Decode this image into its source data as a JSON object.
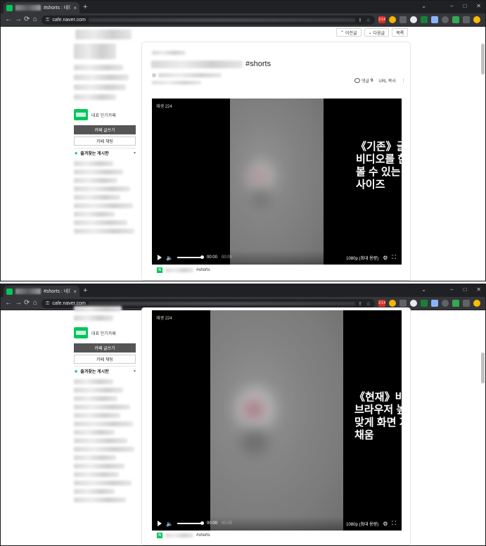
{
  "browser": {
    "tab_title": "#shorts : 네이버",
    "tab_close": "×",
    "new_tab": "+",
    "url": "cafe.naver.com",
    "window_controls": [
      "–",
      "□",
      "✕"
    ],
    "chevron": "⌄",
    "nav": {
      "back": "←",
      "forward": "→",
      "reload": "⟳",
      "home": "⌂"
    },
    "lock": "🔒",
    "ext_badge": "2:14"
  },
  "top": {
    "nav_buttons": {
      "prev": "이전글",
      "next": "다음글",
      "list": "목록"
    },
    "sidebar": {
      "badge_label": "대표 인기카페",
      "write_button": "카페 글쓰기",
      "chat_button": "카페 채팅",
      "favorites_label": "즐겨찾는 게시판"
    },
    "post": {
      "title_tag": "#shorts",
      "comment_label": "댓글",
      "comment_count": "9",
      "url_copy": "URL 복사",
      "more": "⋮"
    },
    "video": {
      "label": "재생 224",
      "time_current": "00:00",
      "time_total": "00:05",
      "quality": "1080p (최대 용량)"
    },
    "under_video_tag": "#shorts",
    "caption": "《기존》글 제목과\n비디오를 한 눈에\n볼 수 있는 적당한\n사이즈"
  },
  "bottom": {
    "sidebar": {
      "badge_label": "대표 인기카페",
      "write_button": "카페 글쓰기",
      "chat_button": "카페 채팅",
      "favorites_label": "즐겨찾는 게시판"
    },
    "video": {
      "label": "재생 224",
      "time_current": "00:00",
      "time_total": "00:05",
      "quality": "1080p (최대 용량)"
    },
    "under_video_tag": "#shorts",
    "caption": "《현재》비디오를\n브라우저 높이에\n맞게 화면 가득\n채움"
  },
  "colors": {
    "naver_green": "#03c75a",
    "chrome_dark": "#202124",
    "chrome_toolbar": "#35363a"
  },
  "icons": [
    "favicon-icon",
    "back-icon",
    "forward-icon",
    "reload-icon",
    "home-icon",
    "lock-icon",
    "share-icon",
    "bookmark-star-icon",
    "play-icon",
    "volume-icon",
    "settings-gear-icon",
    "fullscreen-icon",
    "comment-icon",
    "star-icon"
  ]
}
